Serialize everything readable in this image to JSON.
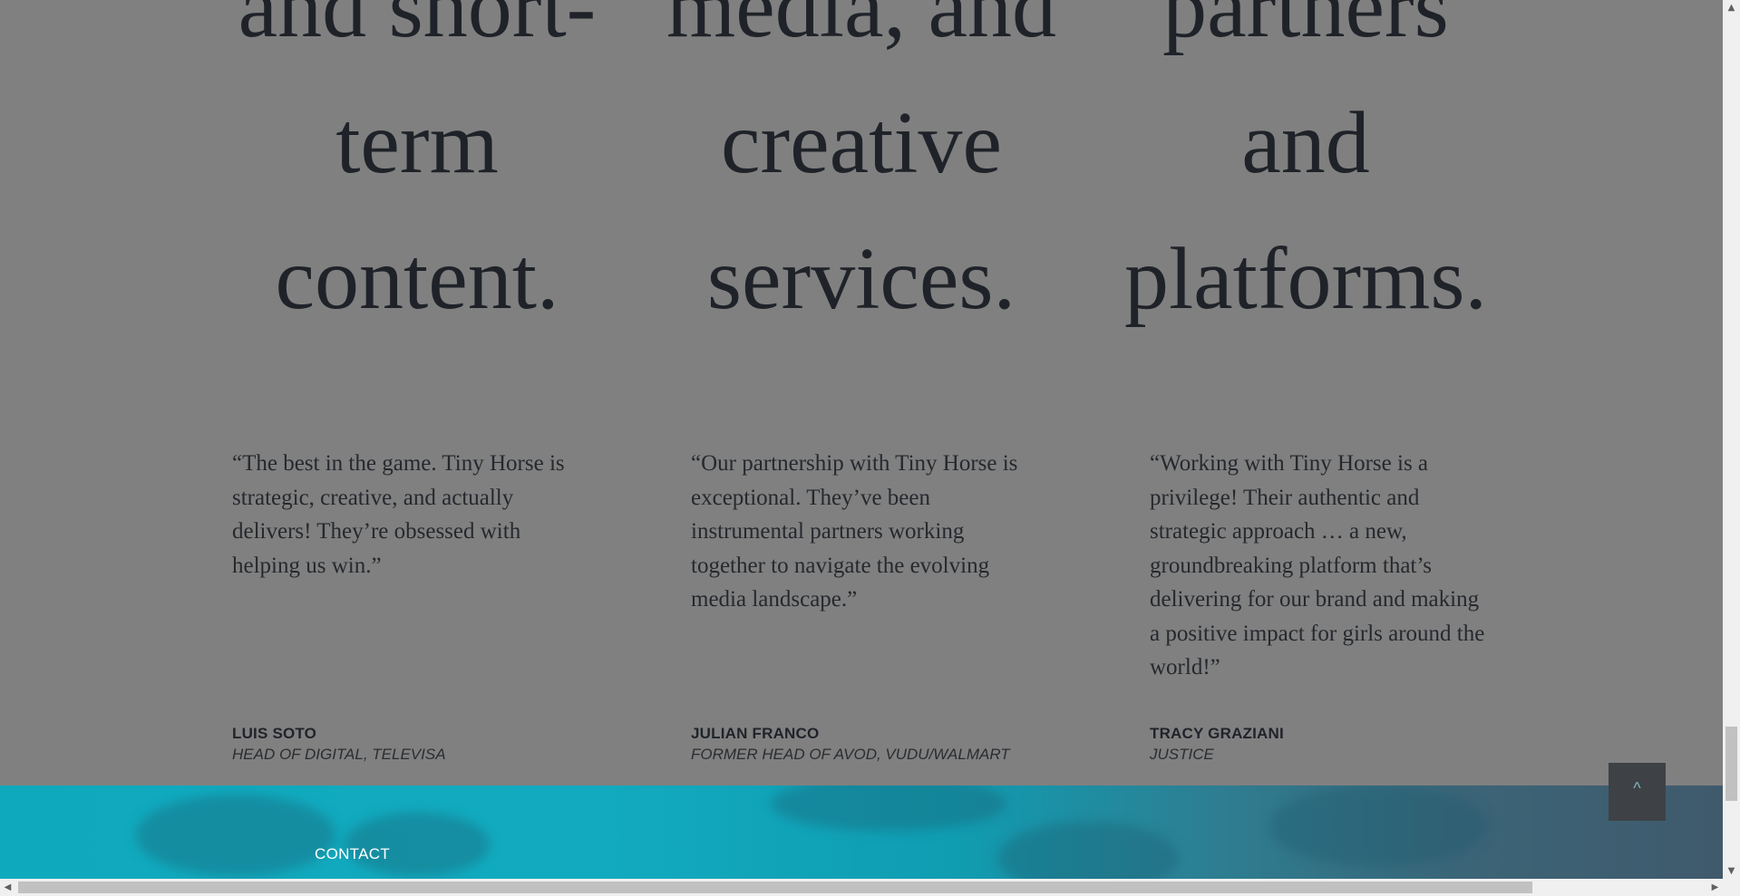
{
  "headlines": [
    {
      "lines": [
        "and short-",
        "term",
        "content."
      ]
    },
    {
      "lines": [
        "media, and",
        "creative",
        "services."
      ]
    },
    {
      "lines": [
        "partners",
        "and",
        "platforms."
      ]
    }
  ],
  "testimonials": [
    {
      "quote": "“The best in the game. Tiny Horse is strategic, creative, and actually delivers! They’re obsessed with helping us win.”",
      "name": "LUIS SOTO",
      "role": "HEAD OF DIGITAL, TELEVISA"
    },
    {
      "quote": "“Our partnership with Tiny Horse is exceptional. They’ve been instrumental partners working together to navigate the evolving media landscape.”",
      "name": "JULIAN FRANCO",
      "role": "FORMER HEAD OF AVOD, VUDU/WALMART"
    },
    {
      "quote": "“Working with Tiny Horse is a privilege! Their authentic and strategic approach … a new, groundbreaking platform that’s delivering for our brand and making a positive impact for girls around the world!”",
      "name": "TRACY GRAZIANI",
      "role": "JUSTICE"
    }
  ],
  "footer": {
    "contact_label": "CONTACT"
  },
  "back_to_top": {
    "label": "^"
  },
  "scrollbars": {
    "up_arrow": "▲",
    "down_arrow": "▼",
    "left_arrow": "◀",
    "right_arrow": "▶"
  }
}
